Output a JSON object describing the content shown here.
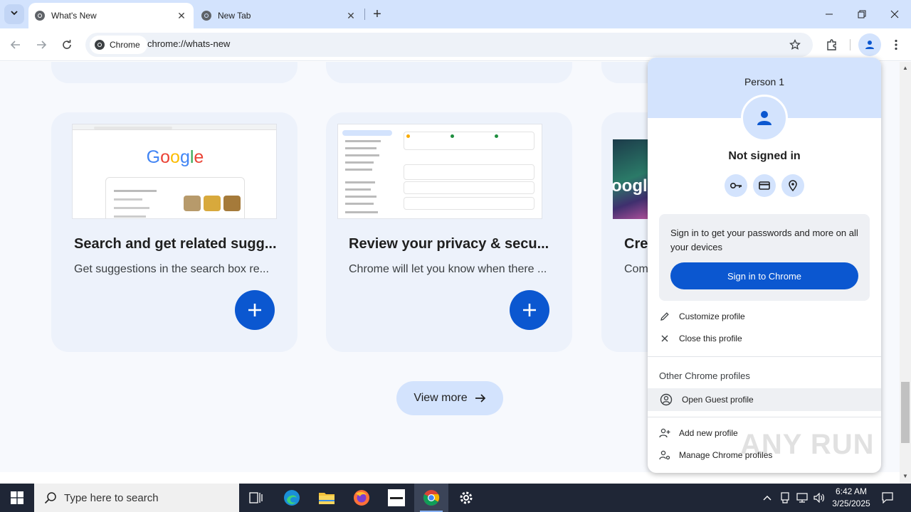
{
  "browser": {
    "tabs": [
      {
        "title": "What's New",
        "active": true
      },
      {
        "title": "New Tab",
        "active": false
      }
    ],
    "chip_label": "Chrome",
    "url": "chrome://whats-new"
  },
  "cards": [
    {
      "title": "Search and get related sugg...",
      "desc": "Get suggestions in the search box re...",
      "shot_logo": "Google"
    },
    {
      "title": "Review your privacy & secu...",
      "desc": "Chrome will let you know when there ..."
    },
    {
      "title": "Cre",
      "desc": "Com",
      "shot_logo": "oogle"
    }
  ],
  "view_more": "View more",
  "profile_menu": {
    "name": "Person 1",
    "status": "Not signed in",
    "signin_text": "Sign in to get your passwords and more on all your devices",
    "signin_button": "Sign in to Chrome",
    "customize": "Customize profile",
    "close": "Close this profile",
    "other_label": "Other Chrome profiles",
    "guest": "Open Guest profile",
    "add": "Add new profile",
    "manage": "Manage Chrome profiles"
  },
  "watermark": "ANY RUN",
  "taskbar": {
    "search_placeholder": "Type here to search",
    "time": "6:42 AM",
    "date": "3/25/2025"
  },
  "colors": {
    "accent": "#0b57d0",
    "tab_strip": "#d3e3fd",
    "taskbar": "#1f2636"
  }
}
